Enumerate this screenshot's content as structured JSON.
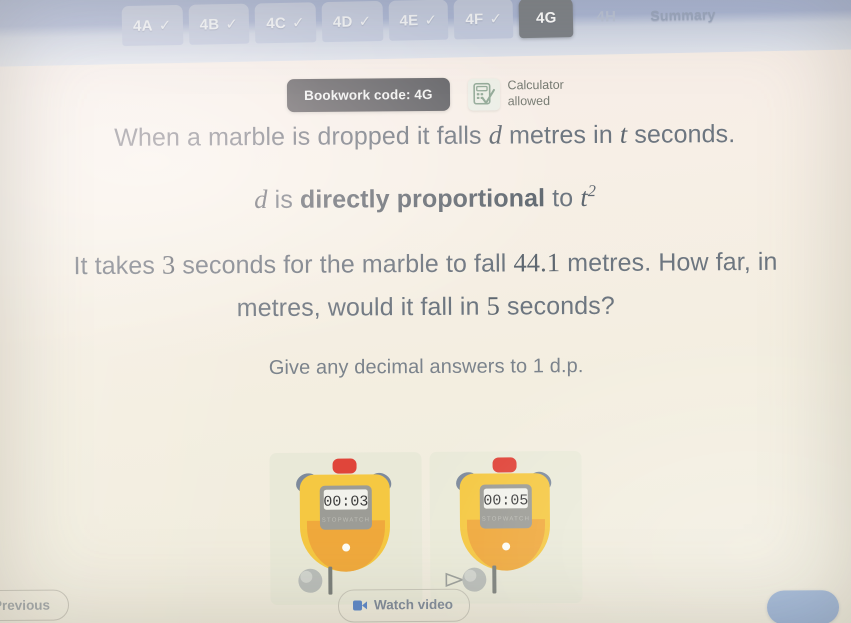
{
  "topbar": {
    "tabs": [
      {
        "label": "4A",
        "state": "done",
        "icon": "check-icon"
      },
      {
        "label": "4B",
        "state": "done",
        "icon": "check-icon"
      },
      {
        "label": "4C",
        "state": "done",
        "icon": "check-icon"
      },
      {
        "label": "4D",
        "state": "done",
        "icon": "check-icon"
      },
      {
        "label": "4E",
        "state": "done",
        "icon": "check-icon"
      },
      {
        "label": "4F",
        "state": "done",
        "icon": "check-icon"
      },
      {
        "label": "4G",
        "state": "active",
        "icon": ""
      },
      {
        "label": "4H",
        "state": "upcoming",
        "icon": ""
      },
      {
        "label": "Summary",
        "state": "summary",
        "icon": ""
      }
    ],
    "check_glyph": "✓",
    "active_tab": "4G"
  },
  "bookwork": {
    "code_label": "Bookwork code: 4G",
    "calculator_line1": "Calculator",
    "calculator_line2": "allowed",
    "calculator_icon": "calculator-allowed-icon"
  },
  "question": {
    "line1_a": "When a marble is dropped it falls ",
    "line1_var": "d",
    "line1_b": " metres in ",
    "line1_var2": "t",
    "line1_c": " seconds.",
    "line2_var": "d",
    "line2_a": " is ",
    "line2_bold": "directly proportional",
    "line2_b": " to ",
    "line2_var2": "t",
    "line2_sup": "2",
    "line3_a": "It takes ",
    "line3_num1": "3",
    "line3_b": " seconds for the marble to fall ",
    "line3_num2": "44.1",
    "line3_c": " metres. How far, in",
    "line4_a": "metres, would it fall in ",
    "line4_num": "5",
    "line4_b": " seconds?",
    "line5": "Give any decimal answers to 1 d.p."
  },
  "figures": [
    {
      "name": "stopwatch-3-seconds",
      "time": "00:03",
      "brand": "STOPWATCH",
      "moving": false
    },
    {
      "name": "stopwatch-5-seconds",
      "time": "00:05",
      "brand": "STOPWATCH",
      "moving": true
    }
  ],
  "bottombar": {
    "previous_label": "Previous",
    "watch_video_label": "Watch video",
    "watch_video_icon": "video-camera-icon",
    "next_label": ""
  },
  "colors": {
    "topbar": "#aab6d6",
    "tab_inactive": "#c3cbe0",
    "tab_active": "#7c8087",
    "page_bg": "#f4efe4",
    "text": "#6d7680",
    "pill": "#5f6165",
    "accent_blue": "#8aa6cf",
    "stopwatch_body": "#f5c842",
    "stopwatch_button": "#e0453a"
  }
}
